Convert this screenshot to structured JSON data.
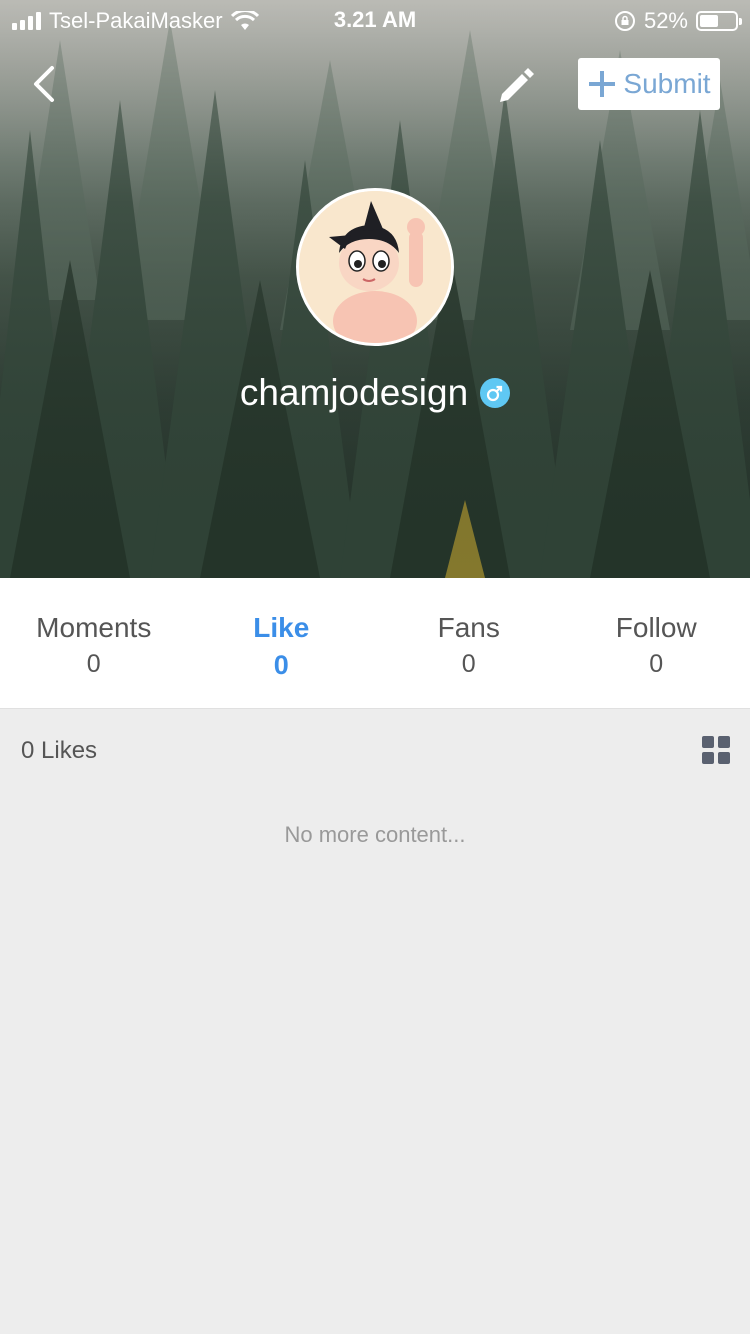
{
  "status_bar": {
    "carrier": "Tsel-PakaiMasker",
    "time": "3.21 AM",
    "battery": "52%",
    "battery_level": 0.52
  },
  "header": {
    "back_icon": "chevron-left-icon",
    "edit_icon": "pencil-icon",
    "submit_label": "Submit"
  },
  "profile": {
    "username": "chamjodesign",
    "gender_icon": "male-icon",
    "gender_color": "#5fc8f3"
  },
  "stats": [
    {
      "label": "Moments",
      "count": "0"
    },
    {
      "label": "Like",
      "count": "0"
    },
    {
      "label": "Fans",
      "count": "0"
    },
    {
      "label": "Follow",
      "count": "0"
    }
  ],
  "active_tab": "Like",
  "accent_color": "#3b8ee8",
  "content": {
    "likes_title": "0 Likes",
    "view_icon": "grid-view-icon",
    "empty_text": "No more content..."
  }
}
